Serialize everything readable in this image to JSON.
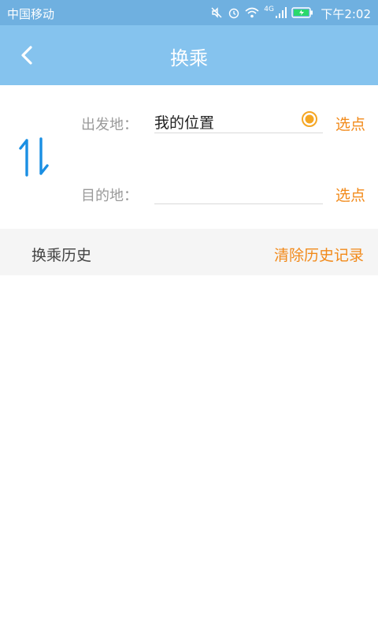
{
  "status_bar": {
    "carrier": "中国移动",
    "network": "4G",
    "time": "下午2:02",
    "icons": [
      "mute-icon",
      "alarm-icon",
      "wifi-icon",
      "signal-icon",
      "battery-charging-icon"
    ]
  },
  "header": {
    "title": "换乘"
  },
  "form": {
    "origin_label": "出发地：",
    "origin_value": "我的位置",
    "origin_pick": "选点",
    "destination_label": "目的地：",
    "destination_value": "",
    "destination_pick": "选点"
  },
  "history": {
    "title": "换乘历史",
    "clear_label": "清除历史记录"
  },
  "colors": {
    "status_bar": "#6fb0e0",
    "header": "#85c3ee",
    "accent_orange": "#f28a1a",
    "swap_blue": "#1a8fe3"
  }
}
